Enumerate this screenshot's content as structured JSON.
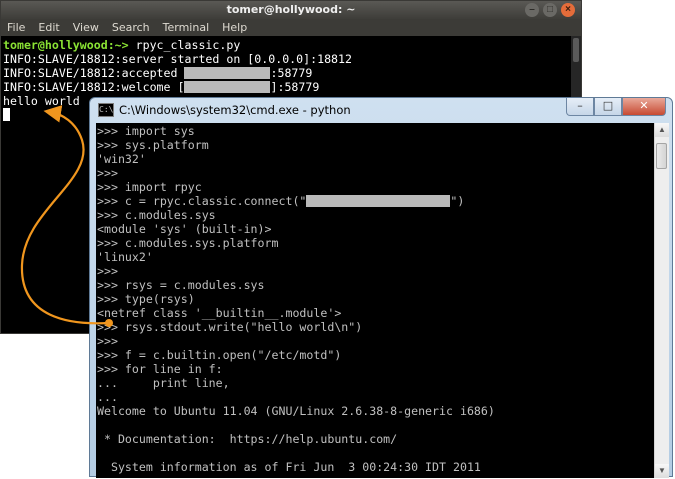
{
  "ubuntu_terminal": {
    "title": "tomer@hollywood: ~",
    "window_buttons": [
      "–",
      "□",
      "×"
    ],
    "menu": [
      "File",
      "Edit",
      "View",
      "Search",
      "Terminal",
      "Help"
    ],
    "prompt_user": "tomer@hollywood:~>",
    "command": " rpyc_classic.py",
    "log_server": "INFO:SLAVE/18812:server started on [0.0.0.0]:18812",
    "log_accepted_prefix": "INFO:SLAVE/18812:accepted ",
    "log_accepted_suffix": ":58779",
    "log_welcome_prefix": "INFO:SLAVE/18812:welcome [",
    "log_welcome_suffix": "]:58779",
    "output": "hello world"
  },
  "cmd_window": {
    "title": "C:\\Windows\\system32\\cmd.exe - python",
    "icon_text": "C:\\",
    "window_buttons": [
      "–",
      "□",
      "✕"
    ],
    "scroll_up": "▲",
    "scroll_down": "▼",
    "lines": {
      "l01": ">>> import sys",
      "l02": ">>> sys.platform",
      "l03": "'win32'",
      "l04": ">>>",
      "l05": ">>> import rpyc",
      "l06_prefix": ">>> c = rpyc.classic.connect(\"",
      "l06_suffix": "\")",
      "l07": ">>> c.modules.sys",
      "l08": "<module 'sys' (built-in)>",
      "l09": ">>> c.modules.sys.platform",
      "l10": "'linux2'",
      "l11": ">>>",
      "l12": ">>> rsys = c.modules.sys",
      "l13": ">>> type(rsys)",
      "l14": "<netref class '__builtin__.module'>",
      "l15": ">>> rsys.stdout.write(\"hello world\\n\")",
      "l16": ">>>",
      "l17": ">>> f = c.builtin.open(\"/etc/motd\")",
      "l18": ">>> for line in f:",
      "l19": "...     print line,",
      "l20": "...",
      "l21": "Welcome to Ubuntu 11.04 (GNU/Linux 2.6.38-8-generic i686)",
      "l22": "",
      "l23": " * Documentation:  https://help.ubuntu.com/",
      "l24": "",
      "l25": "  System information as of Fri Jun  3 00:24:30 IDT 2011"
    }
  },
  "colors": {
    "annotation_arrow": "#f0961e",
    "prompt_green": "#8ae234",
    "redaction_gray": "#b9b9b9",
    "cmd_text": "#c0c0c0"
  }
}
